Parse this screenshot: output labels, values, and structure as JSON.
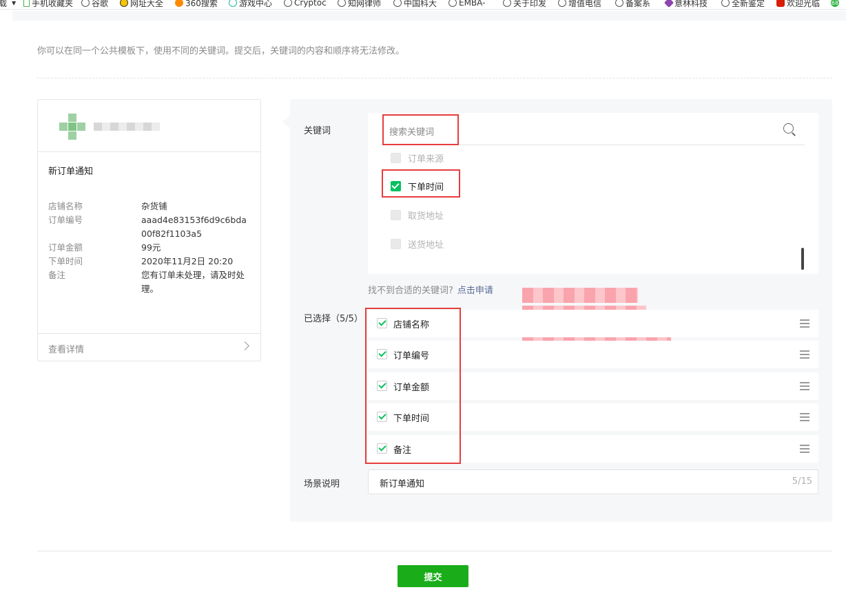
{
  "bookmarks": [
    {
      "label": "载",
      "icon": "none"
    },
    {
      "label": "手机收藏夹",
      "icon": "doc"
    },
    {
      "label": "谷歌",
      "icon": "globe"
    },
    {
      "label": "网址大全",
      "icon": "yellow"
    },
    {
      "label": "360搜索",
      "icon": "orange"
    },
    {
      "label": "游戏中心",
      "icon": "teal"
    },
    {
      "label": "Cryptoc",
      "icon": "globe"
    },
    {
      "label": "知网律师",
      "icon": "globe"
    },
    {
      "label": "中国科大",
      "icon": "globe"
    },
    {
      "label": "EMBA-",
      "icon": "globe"
    },
    {
      "label": "关于印发",
      "icon": "globe"
    },
    {
      "label": "增值电信",
      "icon": "globe"
    },
    {
      "label": "备案系",
      "icon": "globe"
    },
    {
      "label": "意林科技",
      "icon": "purple"
    },
    {
      "label": "全新鉴定",
      "icon": "globe"
    },
    {
      "label": "欢迎光临",
      "icon": "red"
    },
    {
      "label": "68",
      "icon": "circle68"
    }
  ],
  "tip": "你可以在同一个公共模板下，使用不同的关键词。提交后，关键词的内容和顺序将无法修改。",
  "preview": {
    "title": "新订单通知",
    "fields": [
      {
        "key": "店铺名称",
        "value": "杂货铺"
      },
      {
        "key": "订单编号",
        "value": "aaad4e83153f6d9c6bda00f82f1103a5"
      },
      {
        "key": "订单金额",
        "value": "99元"
      },
      {
        "key": "下单时间",
        "value": "2020年11月2日 20:20"
      },
      {
        "key": "备注",
        "value": "您有订单未处理，请及时处理。"
      }
    ],
    "detail_label": "查看详情"
  },
  "keywords": {
    "label": "关键词",
    "search_placeholder": "搜索关键词",
    "options": [
      {
        "label": "订单来源",
        "state": "disabled"
      },
      {
        "label": "下单时间",
        "state": "checked"
      },
      {
        "label": "取货地址",
        "state": "disabled"
      },
      {
        "label": "送货地址",
        "state": "disabled"
      }
    ],
    "not_found": "找不到合适的关键词?",
    "apply_link": "点击申请"
  },
  "selected": {
    "label": "已选择（5/5）",
    "items": [
      "店铺名称",
      "订单编号",
      "订单金额",
      "下单时间",
      "备注"
    ]
  },
  "scene": {
    "label": "场景说明",
    "value": "新订单通知",
    "counter": "5/15"
  },
  "submit_label": "提交",
  "colors": {
    "accent": "#07c160",
    "submit": "#1aad19",
    "link": "#576b95",
    "highlight": "#e63c3c"
  }
}
